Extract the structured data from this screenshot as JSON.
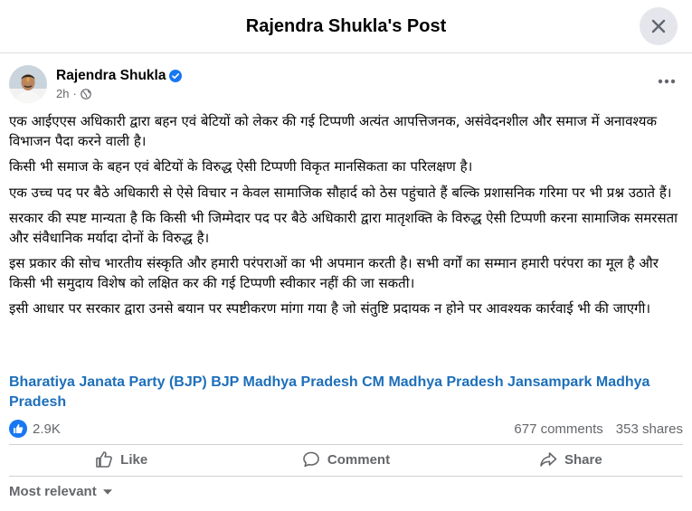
{
  "header": {
    "title": "Rajendra Shukla's Post"
  },
  "author": {
    "name": "Rajendra Shukla",
    "time": "2h",
    "time_separator": "·"
  },
  "post": {
    "paragraphs": [
      "एक आईएएस अधिकारी द्वारा बहन एवं बेटियों को लेकर की गई टिप्पणी अत्यंत आपत्तिजनक, असंवेदनशील और समाज में अनावश्यक विभाजन पैदा करने वाली है।",
      "किसी भी समाज के बहन एवं बेटियों के विरुद्ध ऐसी टिप्पणी विकृत मानसिकता का परिलक्षण है।",
      "एक उच्च पद पर बैठे अधिकारी से ऐसे विचार न केवल सामाजिक सौहार्द को ठेस पहुंचाते हैं बल्कि प्रशासनिक गरिमा पर भी प्रश्न उठाते हैं।",
      "सरकार की स्पष्ट मान्यता है कि किसी भी जिम्मेदार पद पर बैठे अधिकारी द्वारा मातृशक्ति के विरुद्ध ऐसी टिप्पणी करना सामाजिक समरसता और संवैधानिक मर्यादा दोनों के विरुद्ध है।",
      "इस प्रकार की सोच भारतीय संस्कृति और हमारी परंपराओं का भी अपमान करती है। सभी वर्गों का सम्मान हमारी परंपरा का मूल है और किसी भी समुदाय विशेष को लक्षित कर की गई टिप्पणी स्वीकार नहीं की जा सकती।",
      "इसी आधार पर सरकार द्वारा उनसे बयान पर स्पष्टीकरण मांगा गया है जो संतुष्टि प्रदायक न होने पर आवश्यक कार्रवाई भी की जाएगी।"
    ],
    "tags": [
      "Bharatiya Janata Party (BJP)",
      "BJP Madhya Pradesh",
      "CM Madhya Pradesh",
      "Jansampark Madhya Pradesh"
    ]
  },
  "stats": {
    "reactions": "2.9K",
    "comments": "677 comments",
    "shares": "353 shares"
  },
  "actions": {
    "like": "Like",
    "comment": "Comment",
    "share": "Share"
  },
  "sort": {
    "label": "Most relevant"
  },
  "colors": {
    "accent": "#1877f2",
    "tag": "#1d6fba",
    "muted": "#65676b"
  },
  "icons": [
    "close-icon",
    "verified-badge-icon",
    "globe-icon",
    "more-horizontal-icon",
    "like-reaction-icon",
    "thumbs-up-icon",
    "comment-icon",
    "share-icon",
    "chevron-down-icon"
  ]
}
